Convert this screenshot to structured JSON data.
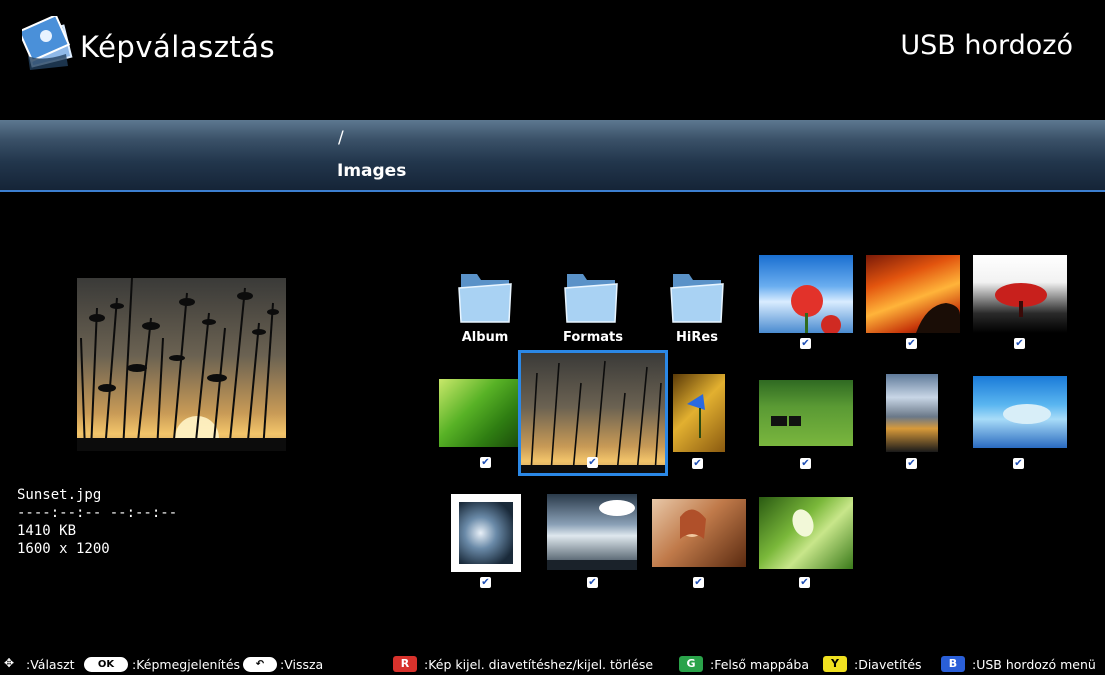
{
  "header": {
    "title": "Képválasztás",
    "source": "USB hordozó"
  },
  "path": {
    "root": "/",
    "current": "Images"
  },
  "preview": {
    "filename": "Sunset.jpg",
    "date": "----:--:-- --:--:--",
    "size": "1410 KB",
    "resolution": "1600 x 1200"
  },
  "folders": [
    {
      "label": "Album"
    },
    {
      "label": "Formats"
    },
    {
      "label": "HiRes"
    }
  ],
  "footer": {
    "select_label": ":Választ",
    "ok_label": "OK",
    "view_label": ":Képmegjelenítés",
    "back_label": ":Vissza",
    "red_key": "R",
    "red_label": ":Kép kijel. diavetítéshez/kijel. törlése",
    "green_key": "G",
    "green_label": ":Felső mappába",
    "yellow_key": "Y",
    "yellow_label": ":Diavetítés",
    "blue_key": "B",
    "blue_label": ":USB hordozó menü"
  },
  "colors": {
    "accent": "#2b88e6",
    "red_key": "#d8322c",
    "green_key": "#2aa34a",
    "yellow_key": "#f0e020",
    "blue_key": "#2a5fd8"
  }
}
